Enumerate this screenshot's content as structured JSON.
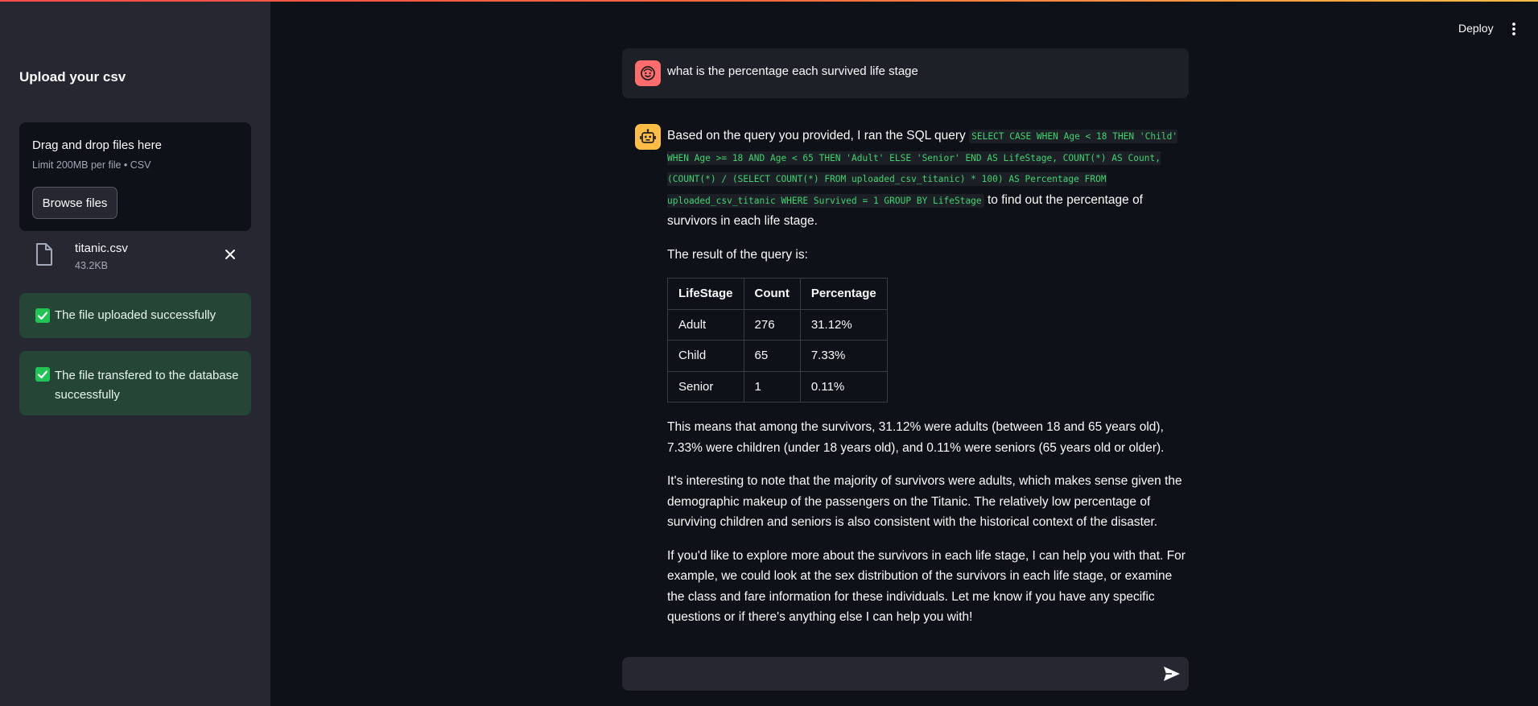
{
  "sidebar": {
    "title": "Upload your csv",
    "uploader": {
      "drop_label": "Drag and drop files here",
      "limit_label": "Limit 200MB per file • CSV",
      "browse_label": "Browse files"
    },
    "file": {
      "name": "titanic.csv",
      "size": "43.2KB"
    },
    "alerts": [
      "The file uploaded successfully",
      "The file transfered to the database successfully"
    ]
  },
  "header": {
    "deploy_label": "Deploy"
  },
  "chat": {
    "user_message": "what is the percentage each survived life stage",
    "bot": {
      "intro_before": "Based on the query you provided, I ran the SQL query ",
      "sql": "SELECT CASE WHEN Age < 18 THEN 'Child' WHEN Age >= 18 AND Age < 65 THEN 'Adult' ELSE 'Senior' END AS LifeStage, COUNT(*) AS Count, (COUNT(*) / (SELECT COUNT(*) FROM uploaded_csv_titanic) * 100) AS Percentage FROM uploaded_csv_titanic WHERE Survived = 1 GROUP BY LifeStage",
      "intro_after": " to find out the percentage of survivors in each life stage.",
      "result_label": "The result of the query is:",
      "table": {
        "headers": [
          "LifeStage",
          "Count",
          "Percentage"
        ],
        "rows": [
          [
            "Adult",
            "276",
            "31.12%"
          ],
          [
            "Child",
            "65",
            "7.33%"
          ],
          [
            "Senior",
            "1",
            "0.11%"
          ]
        ]
      },
      "para1": "This means that among the survivors, 31.12% were adults (between 18 and 65 years old), 7.33% were children (under 18 years old), and 0.11% were seniors (65 years old or older).",
      "para2": "It's interesting to note that the majority of survivors were adults, which makes sense given the demographic makeup of the passengers on the Titanic. The relatively low percentage of surviving children and seniors is also consistent with the historical context of the disaster.",
      "para3": "If you'd like to explore more about the survivors in each life stage, I can help you with that. For example, we could look at the sex distribution of the survivors in each life stage, or examine the class and fare information for these individuals. Let me know if you have any specific questions or if there's anything else I can help you with!"
    }
  },
  "input": {
    "placeholder": ""
  },
  "colors": {
    "accent_red": "#ff4b4b",
    "success_green": "#21c354",
    "user_avatar": "#ff6c6c",
    "bot_avatar": "#ffbd45",
    "code_green": "#3dd56d"
  },
  "icons": {
    "file": "file-icon",
    "close": "close-icon",
    "check": "check-icon",
    "user_avatar": "smiley-face-icon",
    "bot_avatar": "robot-icon",
    "menu": "kebab-menu-icon",
    "send": "send-icon"
  }
}
